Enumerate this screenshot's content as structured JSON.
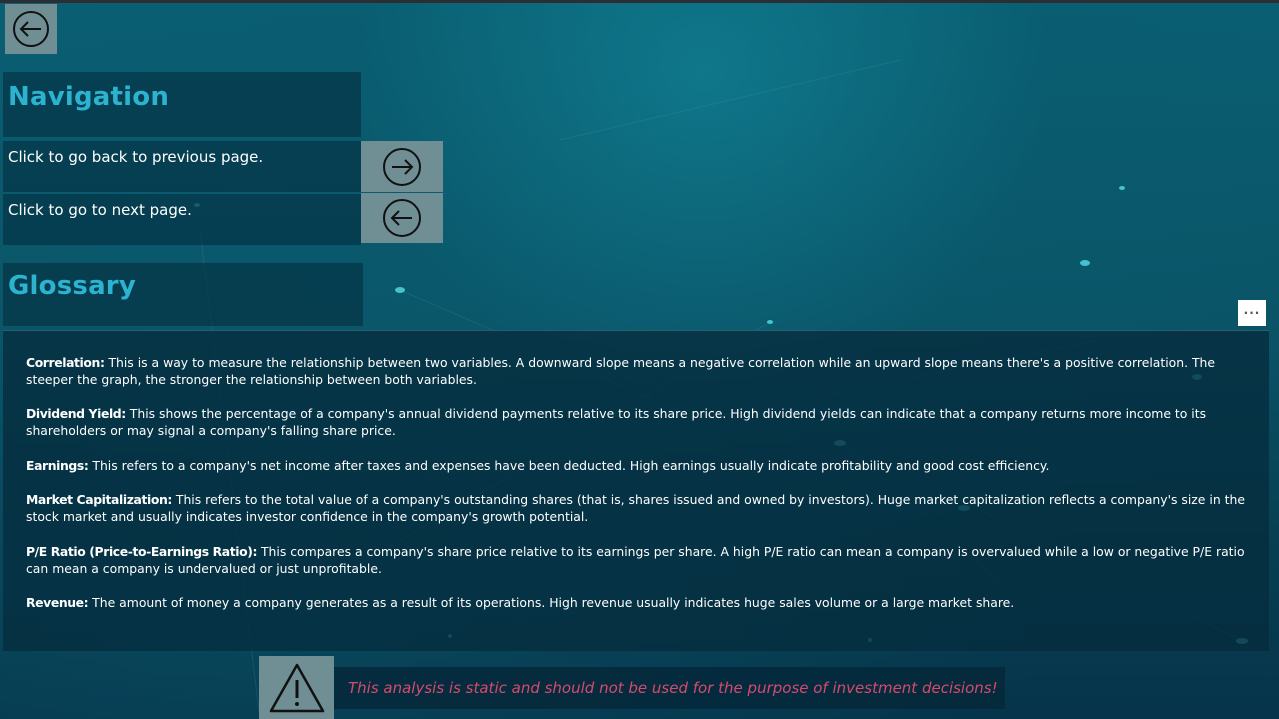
{
  "topbar": {
    "back_icon": "arrow-left-circle-icon"
  },
  "navigation": {
    "title": "Navigation",
    "rows": [
      {
        "label": "Click to go back to previous page.",
        "icon": "arrow-right-circle-icon"
      },
      {
        "label": "Click to go to next page.",
        "icon": "arrow-left-circle-icon"
      }
    ]
  },
  "glossary": {
    "title": "Glossary",
    "more_icon": "more-options-icon",
    "entries": [
      {
        "term": "Correlation:",
        "text": " This is a way to measure the relationship between two variables. A downward slope means a negative correlation while an upward slope means there's a positive correlation. The steeper the graph, the stronger the relationship between both variables."
      },
      {
        "term": "Dividend Yield:",
        "text": " This shows the percentage of a company's annual dividend payments relative to its share price. High dividend yields can indicate that a company returns more income to its shareholders or may signal a company's falling share price."
      },
      {
        "term": "Earnings:",
        "text": " This refers to a company's net income after taxes and expenses have been deducted. High earnings usually indicate profitability and good cost efficiency."
      },
      {
        "term": "Market Capitalization:",
        "text": "  This refers to the total value of a company's outstanding shares (that is, shares issued and owned by investors). Huge market capitalization reflects a company's size in the stock market and usually indicates investor confidence in the company's growth potential."
      },
      {
        "term": "P/E Ratio (Price-to-Earnings Ratio):",
        "text": " This compares a company's share price relative to its earnings per share. A high P/E ratio can mean a company is overvalued while a low or negative P/E ratio can mean a company is undervalued or just unprofitable."
      },
      {
        "term": "Revenue:",
        "text": " The amount of money a company generates as a result of its operations. High revenue usually indicates huge sales volume or a large market share."
      }
    ]
  },
  "disclaimer": {
    "icon": "warning-icon",
    "text": "This analysis is static and should not be used for the purpose of investment decisions!"
  },
  "colors": {
    "accent": "#2bb3cf",
    "warning": "#d64a6e",
    "button_bg": "#6f8f95"
  }
}
